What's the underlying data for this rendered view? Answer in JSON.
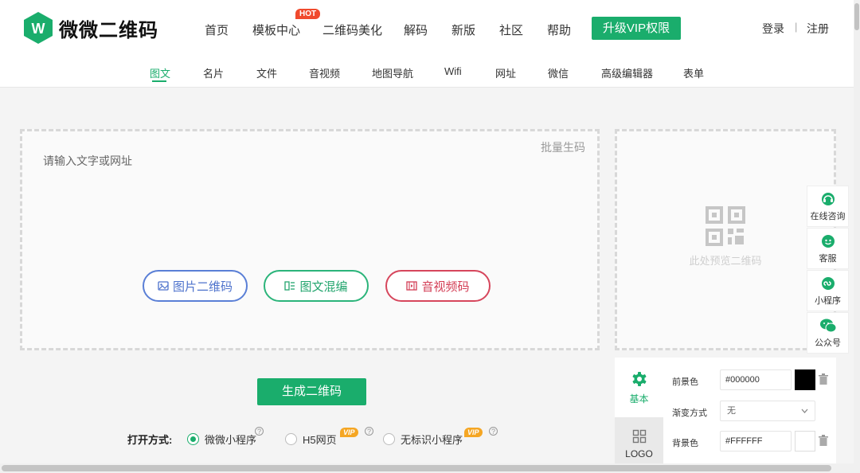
{
  "brand": {
    "name": "微微二维码",
    "logo_letter": "W",
    "color": "#1aad6c"
  },
  "nav": {
    "items": [
      "首页",
      "模板中心",
      "二维码美化",
      "解码",
      "新版",
      "社区",
      "帮助"
    ],
    "hot_badge": "HOT",
    "vip_button": "升级VIP权限",
    "login": "登录",
    "separator": "|",
    "register": "注册"
  },
  "subtabs": {
    "items": [
      "图文",
      "名片",
      "文件",
      "音视频",
      "地图导航",
      "Wifi",
      "网址",
      "微信",
      "高级编辑器",
      "表单"
    ],
    "active": "图文"
  },
  "editor": {
    "placeholder": "请输入文字或网址",
    "batch_link": "批量生码",
    "buttons": [
      "图片二维码",
      "图文混编",
      "音视频码"
    ]
  },
  "preview": {
    "text": "此处预览二维码"
  },
  "float_bar": [
    "在线咨询",
    "客服",
    "小程序",
    "公众号"
  ],
  "generate_button": "生成二维码",
  "open_mode": {
    "label": "打开方式:",
    "help": "?",
    "options": [
      {
        "label": "微微小程序",
        "checked": true
      },
      {
        "label": "H5网页",
        "vip": "VIP"
      },
      {
        "label": "无标识小程序",
        "vip": "VIP"
      }
    ]
  },
  "settings": {
    "tabs": [
      "基本",
      "LOGO"
    ],
    "foreground_label": "前景色",
    "foreground_value": "#000000",
    "gradient_label": "渐变方式",
    "gradient_value": "无",
    "background_label": "背景色",
    "background_value": "#FFFFFF"
  }
}
